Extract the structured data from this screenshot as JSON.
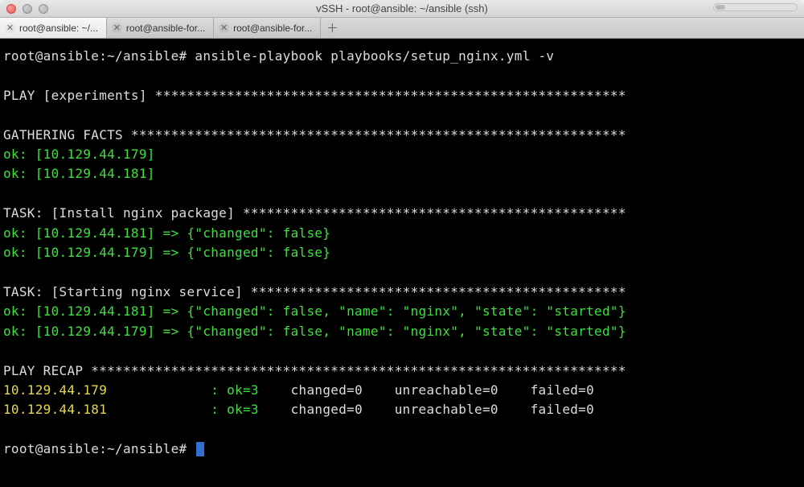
{
  "window": {
    "title": "vSSH - root@ansible: ~/ansible (ssh)"
  },
  "tabs": [
    {
      "label": "root@ansible: ~/...",
      "active": true
    },
    {
      "label": "root@ansible-for...",
      "active": false
    },
    {
      "label": "root@ansible-for...",
      "active": false
    }
  ],
  "prompt": {
    "line1": "root@ansible:~/ansible# ansible-playbook playbooks/setup_nginx.yml -v",
    "line_end": "root@ansible:~/ansible# "
  },
  "play": {
    "header": "PLAY [experiments] ***********************************************************"
  },
  "facts": {
    "header": "GATHERING FACTS **************************************************************",
    "hosts": [
      "ok: [10.129.44.179]",
      "ok: [10.129.44.181]"
    ]
  },
  "task1": {
    "header": "TASK: [Install nginx package] ************************************************",
    "results": [
      "ok: [10.129.44.181] => {\"changed\": false}",
      "ok: [10.129.44.179] => {\"changed\": false}"
    ]
  },
  "task2": {
    "header": "TASK: [Starting nginx service] ***********************************************",
    "results": [
      "ok: [10.129.44.181] => {\"changed\": false, \"name\": \"nginx\", \"state\": \"started\"}",
      "ok: [10.129.44.179] => {\"changed\": false, \"name\": \"nginx\", \"state\": \"started\"}"
    ]
  },
  "recap": {
    "header": "PLAY RECAP *******************************************************************",
    "rows": [
      {
        "host": "10.129.44.179             ",
        "ok": ": ok=3   ",
        "rest": " changed=0    unreachable=0    failed=0"
      },
      {
        "host": "10.129.44.181             ",
        "ok": ": ok=3   ",
        "rest": " changed=0    unreachable=0    failed=0"
      }
    ]
  }
}
